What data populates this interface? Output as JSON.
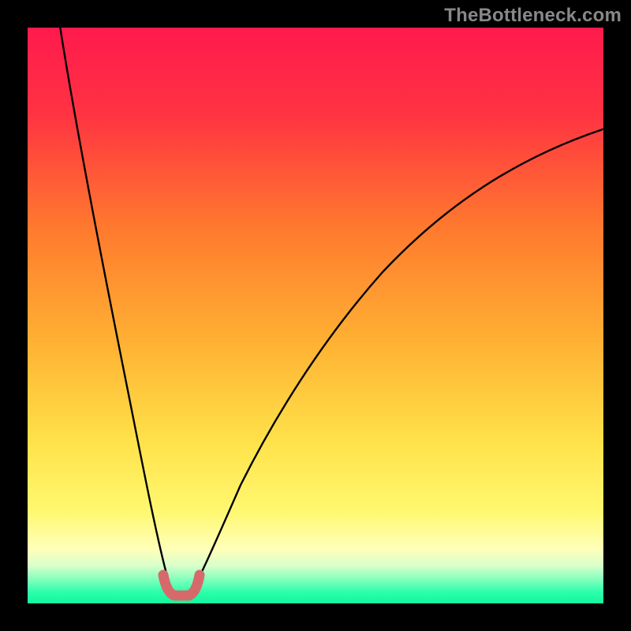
{
  "watermark": "TheBottleneck.com",
  "colors": {
    "frame": "#000000",
    "gradient_stops": [
      {
        "offset": 0.0,
        "color": "#ff1a4d"
      },
      {
        "offset": 0.15,
        "color": "#ff3342"
      },
      {
        "offset": 0.35,
        "color": "#ff7a2e"
      },
      {
        "offset": 0.55,
        "color": "#ffb233"
      },
      {
        "offset": 0.72,
        "color": "#ffe24a"
      },
      {
        "offset": 0.84,
        "color": "#fff870"
      },
      {
        "offset": 0.905,
        "color": "#ffffb8"
      },
      {
        "offset": 0.935,
        "color": "#d8ffcc"
      },
      {
        "offset": 0.96,
        "color": "#7dffbb"
      },
      {
        "offset": 0.98,
        "color": "#2dffab"
      },
      {
        "offset": 1.0,
        "color": "#14f59e"
      }
    ],
    "curve": "#000000",
    "tip_marker": "#d66a6a"
  },
  "chart_data": {
    "type": "line",
    "title": "",
    "xlabel": "",
    "ylabel": "",
    "xlim": [
      0,
      100
    ],
    "ylim": [
      0,
      100
    ],
    "grid": false,
    "legend": false,
    "annotations": [
      "TheBottleneck.com"
    ],
    "note": "No axes, tick labels, or numeric data labels are visible in the image; curve values are estimated from pixel positions on a 0–100 normalized scale where y=0 is the bottom (green) and y=100 is the top (red).",
    "series": [
      {
        "name": "left-branch",
        "x": [
          5.5,
          7,
          9,
          11,
          13,
          15,
          17,
          18.5,
          20,
          21.5,
          23,
          24,
          25
        ],
        "y": [
          100,
          88,
          74,
          61,
          49,
          38,
          28,
          20,
          14,
          9,
          5,
          3,
          2.2
        ]
      },
      {
        "name": "right-branch",
        "x": [
          28.5,
          30,
          32,
          35,
          38,
          42,
          47,
          53,
          60,
          68,
          77,
          87,
          98
        ],
        "y": [
          2.2,
          3,
          6,
          10,
          15,
          22,
          30,
          39,
          48,
          57,
          66,
          74,
          81
        ]
      },
      {
        "name": "tip-marker",
        "style": "thick-pink-u",
        "x": [
          24,
          25,
          26,
          27,
          28,
          29
        ],
        "y": [
          4.5,
          2.3,
          1.6,
          1.6,
          2.3,
          4.5
        ]
      }
    ]
  }
}
